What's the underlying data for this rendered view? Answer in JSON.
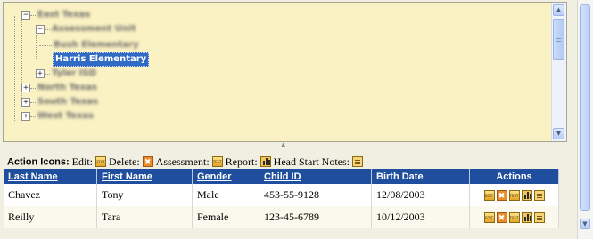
{
  "tree": {
    "nodes": [
      {
        "label": "East Texas",
        "expanded": true,
        "blurred": true
      },
      {
        "label": "Assessment Unit",
        "expanded": true,
        "blurred": true
      },
      {
        "label": "Bush Elementary",
        "blurred": true
      },
      {
        "label": "Harris Elementary",
        "selected": true
      },
      {
        "label": "Tyler ISD",
        "expanded": false,
        "blurred": true
      },
      {
        "label": "North Texas",
        "expanded": false,
        "blurred": true
      },
      {
        "label": "South Texas",
        "expanded": false,
        "blurred": true
      },
      {
        "label": "West Texas",
        "expanded": false,
        "blurred": true
      }
    ],
    "toggle_minus": "−",
    "toggle_plus": "+"
  },
  "scroll": {
    "up": "▲",
    "down": "▼",
    "splitter_arrow": "▲"
  },
  "action_bar": {
    "lead": "Action Icons:",
    "edit": "Edit:",
    "delete": "Delete:",
    "assessment": "Assessment:",
    "report": "Report:",
    "notes": "Head Start Notes:"
  },
  "icons": {
    "edit_text": "EDIT",
    "delete_text": "✖",
    "test_text": "TEST"
  },
  "table": {
    "headers": {
      "last_name": "Last Name",
      "first_name": "First Name",
      "gender": "Gender",
      "child_id": "Child ID",
      "birth_date": "Birth Date",
      "actions": "Actions"
    },
    "rows": [
      {
        "last_name": "Chavez",
        "first_name": "Tony",
        "gender": "Male",
        "child_id": "453-55-9128",
        "birth_date": "12/08/2003"
      },
      {
        "last_name": "Reilly",
        "first_name": "Tara",
        "gender": "Female",
        "child_id": "123-45-6789",
        "birth_date": "10/12/2003"
      }
    ]
  },
  "colors": {
    "tree_bg": "#fbf2c3",
    "header_bg": "#1f4e9f",
    "selection": "#316ac5"
  }
}
